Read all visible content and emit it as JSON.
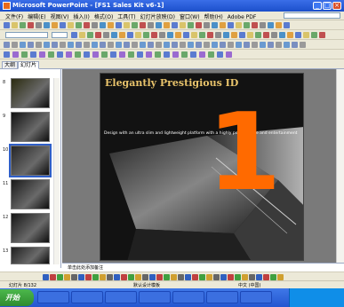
{
  "window": {
    "title": "Microsoft PowerPoint - [FS1 Sales Kit v6-1]",
    "controls": [
      "minimize-icon",
      "maximize-icon",
      "close-icon"
    ]
  },
  "menubar": {
    "items": [
      "文件(F)",
      "编辑(E)",
      "视图(V)",
      "插入(I)",
      "格式(O)",
      "工具(T)",
      "幻灯片放映(D)",
      "窗口(W)",
      "帮助(H)",
      "Adobe PDF"
    ]
  },
  "left_pane": {
    "tabs": [
      "大纲",
      "幻灯片"
    ],
    "slide_numbers": [
      "8",
      "9",
      "10",
      "11",
      "12",
      "13"
    ],
    "selected_index": 2
  },
  "slide": {
    "title": "Elegantly Prestigious ID",
    "subtitle": "Design with an ultra slim and lightweight platform with a highly performance and entertainment",
    "number_overlay": "1"
  },
  "notes": {
    "text": "单击此处添加备注"
  },
  "statusbar": {
    "slide_info": "幻灯片 8/132",
    "design": "默认设计模板",
    "language": "中文 (中国)"
  },
  "taskbar": {
    "start_label": "开始",
    "clock": ""
  }
}
